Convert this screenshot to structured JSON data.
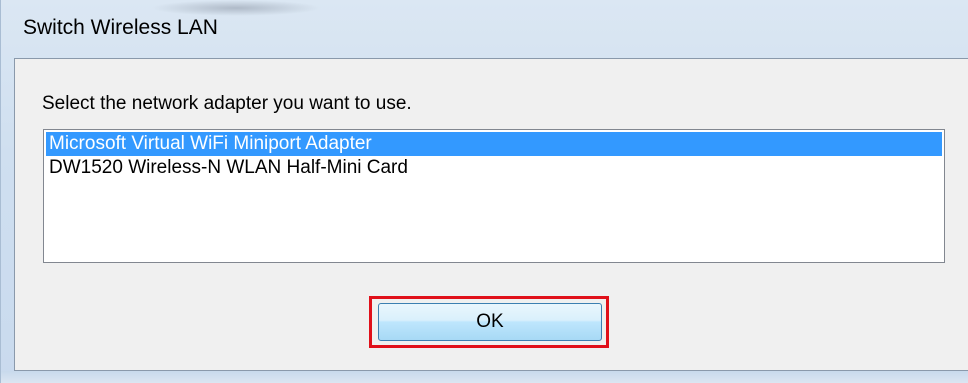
{
  "window": {
    "title": "Switch Wireless LAN"
  },
  "dialog": {
    "prompt": "Select the network adapter you want to use.",
    "adapters": [
      {
        "label": "Microsoft Virtual WiFi Miniport Adapter",
        "selected": true
      },
      {
        "label": "DW1520 Wireless-N WLAN Half-Mini Card",
        "selected": false
      }
    ],
    "ok_label": "OK"
  },
  "colors": {
    "selection": "#3399ff",
    "highlight_box": "#e0101a"
  }
}
